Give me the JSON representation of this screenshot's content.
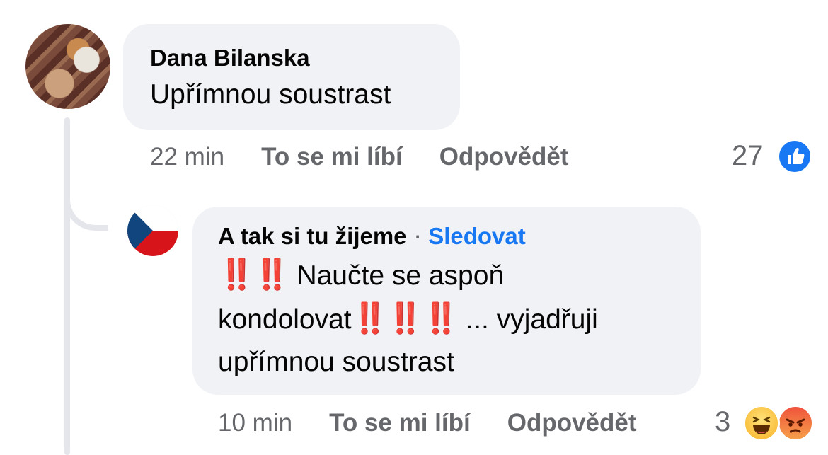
{
  "comments": [
    {
      "author": "Dana Bilanska",
      "text": "Upřímnou soustrast",
      "time": "22 min",
      "like_label": "To se mi líbí",
      "reply_label": "Odpovědět",
      "reaction_count": "27",
      "reactions": [
        "like-icon"
      ]
    }
  ],
  "reply": {
    "author": "A tak si tu žijeme",
    "separator": "·",
    "follow_label": "Sledovat",
    "text_parts": [
      "‼️‼️",
      "Naučte se aspoň",
      "kondolovat",
      "‼️‼️‼️",
      "... vyjadřuji",
      "upřímnou soustrast"
    ],
    "time": "10 min",
    "like_label": "To se mi líbí",
    "reply_label": "Odpovědět",
    "reaction_count": "3",
    "reactions": [
      "haha-icon",
      "angry-icon"
    ]
  },
  "colors": {
    "bubble": "#f0f2f5",
    "meta": "#65676b",
    "link": "#1877f2",
    "emphasis": "#e0141c"
  }
}
